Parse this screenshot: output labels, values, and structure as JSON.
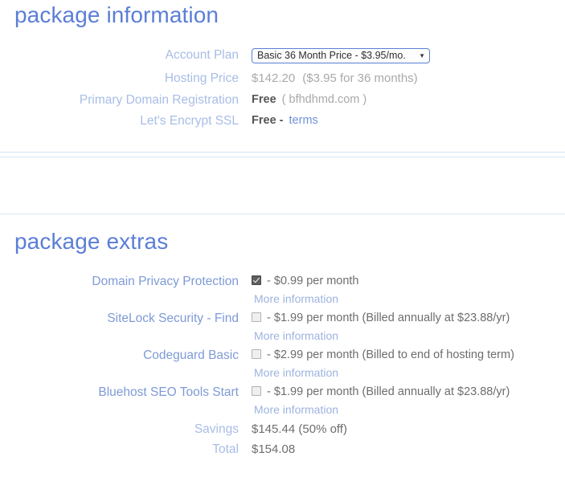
{
  "package_information": {
    "heading": "package information",
    "rows": [
      {
        "label": "Account Plan",
        "type": "select",
        "selected": "Basic 36 Month Price - $3.95/mo.",
        "caret": "▼",
        "options": [
          "Basic 36 Month Price - $3.95/mo."
        ]
      },
      {
        "label": "Hosting Price",
        "type": "price",
        "amount": "$142.20",
        "note": "($3.95 for 36 months)"
      },
      {
        "label": "Primary Domain Registration",
        "type": "free_domain",
        "free_text": "Free",
        "domain": "( bfhdhmd.com )"
      },
      {
        "label": "Let's Encrypt SSL",
        "type": "free_terms",
        "free_text": "Free -",
        "terms_link": "terms"
      }
    ]
  },
  "package_extras": {
    "heading": "package extras",
    "more_information_label": "More information",
    "items": [
      {
        "label": "Domain Privacy Protection",
        "checked": true,
        "price_text": "- $0.99 per month",
        "more_information": "More information"
      },
      {
        "label": "SiteLock Security - Find",
        "checked": false,
        "price_text": "- $1.99 per month (Billed annually at $23.88/yr)",
        "more_information": "More information"
      },
      {
        "label": "Codeguard Basic",
        "checked": false,
        "price_text": "- $2.99 per month (Billed to end of hosting term)",
        "more_information": "More information"
      },
      {
        "label": "Bluehost SEO Tools Start",
        "checked": false,
        "price_text": "- $1.99 per month (Billed annually at $23.88/yr)",
        "more_information": "More information"
      }
    ],
    "totals": [
      {
        "label": "Savings",
        "value": "$145.44 (50% off)"
      },
      {
        "label": "Total",
        "value": "$154.08"
      }
    ]
  },
  "colors": {
    "heading_blue": "#5b7ed6",
    "label_light_blue": "#a8bde6",
    "extra_label_blue": "#7e9ad6",
    "link_blue": "#6f93d8",
    "divider": "#d6e7f3",
    "value_gray": "#a9a9a9",
    "value_dark": "#6d6d6d"
  }
}
